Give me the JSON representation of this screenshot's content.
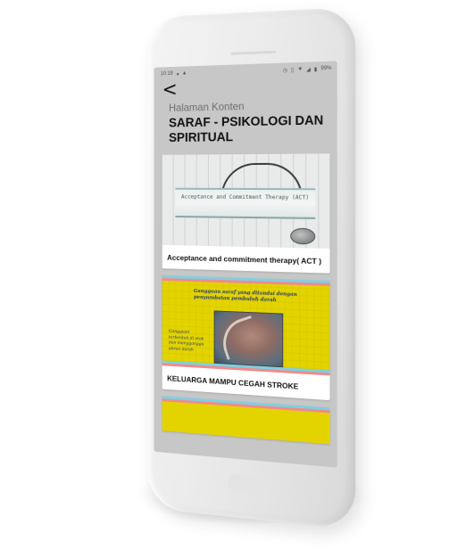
{
  "status_bar": {
    "time": "10:19",
    "left_icons": [
      "navigation-icon",
      "signal-icon"
    ],
    "right_icons": [
      "alarm-icon",
      "vibrate-icon",
      "wifi-icon",
      "cell-signal-icon",
      "battery-icon"
    ],
    "battery": "99%"
  },
  "header": {
    "back_label": "<",
    "subtitle": "Halaman Konten",
    "title": "SARAF - PSIKOLOGI DAN SPIRITUAL"
  },
  "cards": [
    {
      "caption": "Acceptance and commitment therapy( ACT )",
      "image_text": "Acceptance and Commitment Therapy (ACT)"
    },
    {
      "caption": "KELUARGA MAMPU CEGAH STROKE",
      "image_text_top": "Gangguan saraf yang ditandai dengan penyumbatan pembuluh darah",
      "image_text_side": "Gangguan terbentuk di otak dan mengganggu aliran darah"
    }
  ],
  "colors": {
    "screen_bg": "#c7c7c7",
    "card_bg": "#ffffff",
    "stroke_poster": "#e3d400",
    "title_text": "#111111",
    "subtitle_text": "#6e6e6e"
  }
}
